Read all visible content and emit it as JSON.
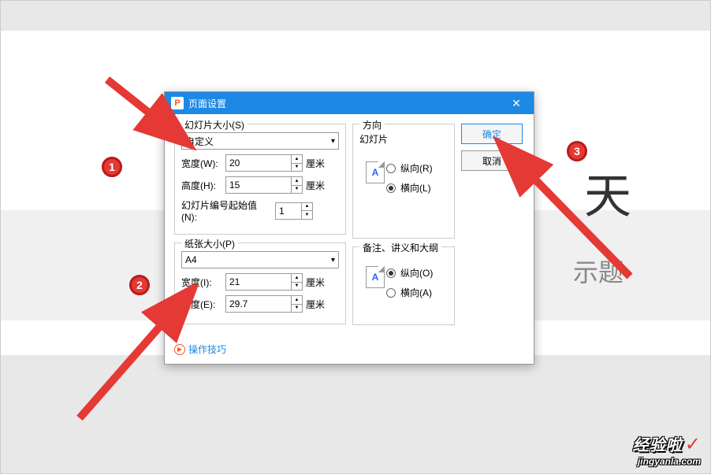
{
  "dialog": {
    "title": "页面设置",
    "slide_size": {
      "group_label": "幻灯片大小(S)",
      "preset": "自定义",
      "width_label": "宽度(W):",
      "width_value": "20",
      "width_unit": "厘米",
      "height_label": "高度(H):",
      "height_value": "15",
      "height_unit": "厘米",
      "start_num_label": "幻灯片编号起始值(N):",
      "start_num_value": "1"
    },
    "paper_size": {
      "group_label": "纸张大小(P)",
      "preset": "A4",
      "width_label": "宽度(I):",
      "width_value": "21",
      "width_unit": "厘米",
      "height_label": "高度(E):",
      "height_value": "29.7",
      "height_unit": "厘米"
    },
    "orientation": {
      "group_label": "方向",
      "slide_label": "幻灯片",
      "portrait_r": "纵向(R)",
      "landscape_l": "横向(L)",
      "notes_label": "备注、讲义和大纲",
      "portrait_o": "纵向(O)",
      "landscape_a": "横向(A)"
    },
    "buttons": {
      "ok": "确定",
      "cancel": "取消"
    },
    "tips_link": "操作技巧"
  },
  "badges": {
    "b1": "1",
    "b2": "2",
    "b3": "3"
  },
  "background": {
    "partial_text_1": "天",
    "partial_text_2": "示题"
  },
  "watermark": {
    "brand": "经验啦",
    "check": "✓",
    "url": "jingyanla.com"
  }
}
